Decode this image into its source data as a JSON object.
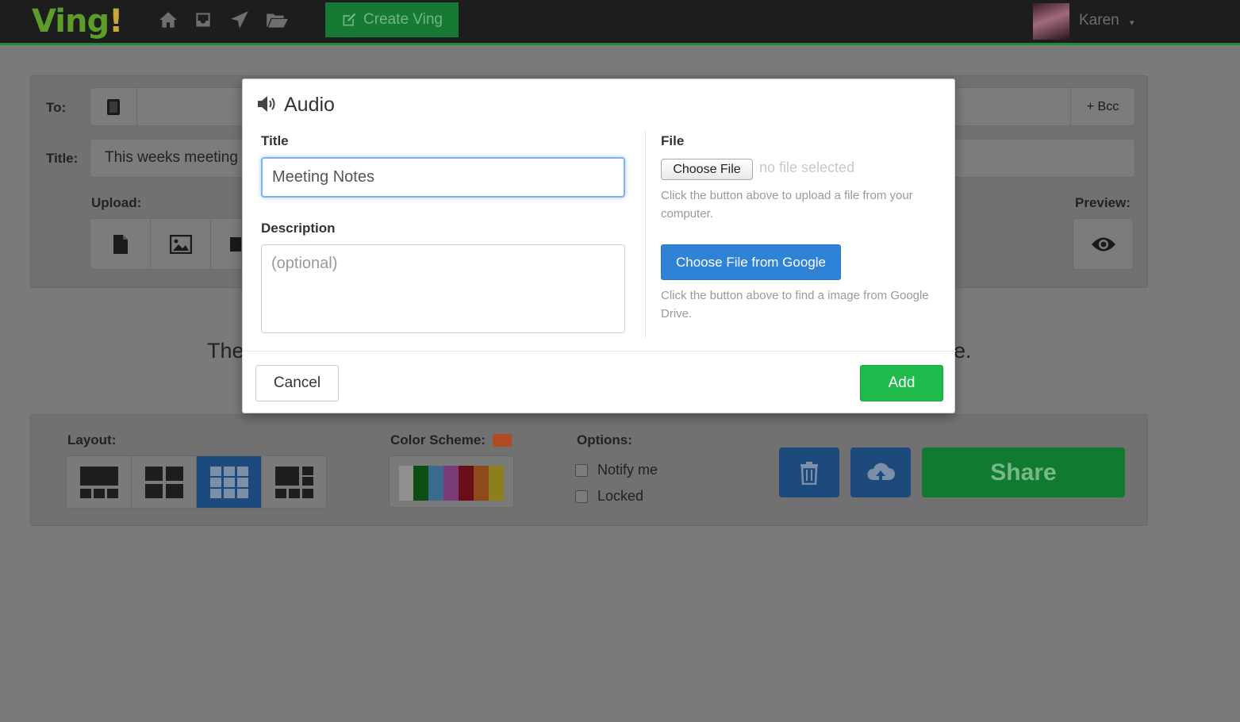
{
  "header": {
    "logo": "Ving",
    "logo_mark": "!",
    "nav_icons": [
      "home-icon",
      "inbox-icon",
      "send-icon",
      "folder-icon"
    ],
    "create_label": "Create Ving",
    "user_name": "Karen",
    "caret": "▾"
  },
  "compose": {
    "to_label": "To:",
    "bcc_label": "+ Bcc",
    "title_label": "Title:",
    "title_value": "This weeks meeting",
    "upload_label": "Upload:",
    "preview_label": "Preview:",
    "body_left": "The",
    "body_right": "e."
  },
  "bottom": {
    "layout_label": "Layout:",
    "color_label": "Color Scheme:",
    "options_label": "Options:",
    "notify_label": "Notify me",
    "locked_label": "Locked",
    "share_label": "Share"
  },
  "modal": {
    "title": "Audio",
    "title_label": "Title",
    "title_value": "Meeting Notes",
    "description_label": "Description",
    "description_placeholder": "(optional)",
    "file_label": "File",
    "choose_file": "Choose File",
    "no_file": "no file selected",
    "file_help": "Click the button above to upload a file from your computer.",
    "google_button": "Choose File from Google",
    "google_help": "Click the button above to find a image from Google Drive.",
    "cancel": "Cancel",
    "add": "Add"
  },
  "colors": {
    "accent_green": "#1fba4b",
    "google_blue": "#2f83d6",
    "scheme_swatch": "#d9552b"
  }
}
